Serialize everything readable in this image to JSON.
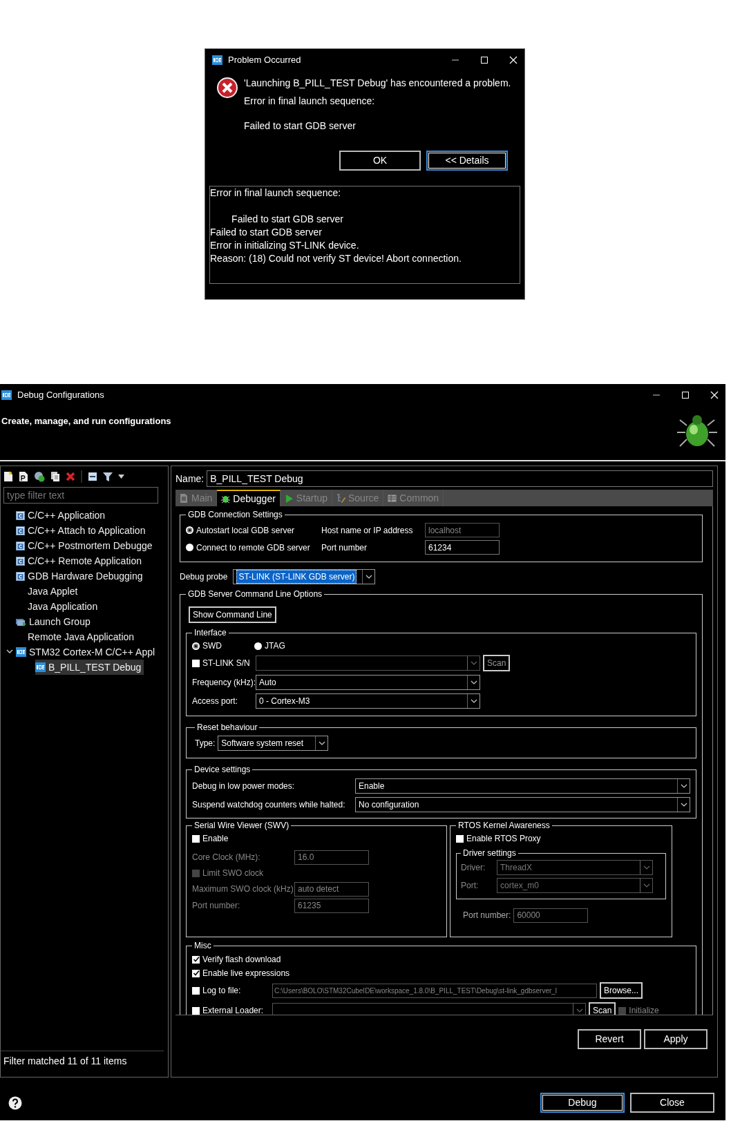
{
  "error_dialog": {
    "title": "Problem Occurred",
    "message": "'Launching B_PILL_TEST Debug' has encountered a problem.",
    "summary": "Error in final launch sequence:",
    "reason": "Failed to start GDB server",
    "buttons": [
      {
        "label": "OK",
        "default": false
      },
      {
        "label": "<< Details",
        "default": true
      }
    ],
    "details": "Error in final launch sequence:\n\n        Failed to start GDB server\nFailed to start GDB server\nError in initializing ST-LINK device.\nReason: (18) Could not verify ST device! Abort connection."
  },
  "window": {
    "title": "Debug Configurations",
    "subtitle": "Create, manage, and run configurations"
  },
  "sidebar": {
    "filter_placeholder": "type filter text",
    "tree": [
      {
        "label": "C/C++ Application",
        "kind": "c",
        "selected": false
      },
      {
        "label": "C/C++ Attach to Application",
        "kind": "c",
        "selected": false
      },
      {
        "label": "C/C++ Postmortem Debugge",
        "kind": "c",
        "selected": false
      },
      {
        "label": "C/C++ Remote Application",
        "kind": "c",
        "selected": false
      },
      {
        "label": "GDB Hardware Debugging",
        "kind": "c",
        "selected": false
      },
      {
        "label": "Java Applet",
        "kind": "plain",
        "selected": false
      },
      {
        "label": "Java Application",
        "kind": "plain",
        "selected": false
      },
      {
        "label": "Launch Group",
        "kind": "launch",
        "selected": false
      },
      {
        "label": "Remote Java Application",
        "kind": "plain",
        "selected": false
      },
      {
        "label": "STM32 Cortex-M C/C++ Appl",
        "kind": "ide",
        "selected": false,
        "expanded": true,
        "children": [
          {
            "label": "B_PILL_TEST Debug",
            "kind": "ide",
            "selected": true
          }
        ]
      }
    ],
    "status": "Filter matched 11 of 11 items"
  },
  "config": {
    "name_label": "Name:",
    "name": "B_PILL_TEST Debug",
    "tabs": [
      {
        "label": "Main",
        "kind": "page",
        "selected": false
      },
      {
        "label": "Debugger",
        "kind": "bug",
        "selected": true
      },
      {
        "label": "Startup",
        "kind": "play",
        "selected": false
      },
      {
        "label": "Source",
        "kind": "source",
        "selected": false
      },
      {
        "label": "Common",
        "kind": "table",
        "selected": false
      }
    ],
    "gdb_connection": {
      "title": "GDB Connection Settings",
      "modes": [
        {
          "label": "Autostart local GDB server",
          "selected": true
        },
        {
          "label": "Connect to remote GDB server",
          "selected": false
        }
      ],
      "host": {
        "label": "Host name or IP address",
        "value": "localhost",
        "disabled": true
      },
      "port": {
        "label": "Port number",
        "value": "61234",
        "disabled": false
      }
    },
    "debug_probe": {
      "label": "Debug probe",
      "value": "ST-LINK (ST-LINK GDB server)"
    },
    "server_options": {
      "title": "GDB Server Command Line Options",
      "show_command_line": "Show Command Line",
      "interface": {
        "title": "Interface",
        "modes": [
          {
            "label": "SWD",
            "selected": true
          },
          {
            "label": "JTAG",
            "selected": false
          }
        ],
        "serial": {
          "label": "ST-LINK S/N",
          "checked": false,
          "scan": "Scan"
        },
        "frequency": {
          "label": "Frequency (kHz):",
          "value": "Auto"
        },
        "access_port": {
          "label": "Access port:",
          "value": "0 - Cortex-M3"
        }
      },
      "reset": {
        "title": "Reset behaviour",
        "type_label": "Type:",
        "type": "Software system reset"
      },
      "device": {
        "title": "Device settings",
        "rows": [
          {
            "label": "Debug in low power modes:",
            "value": "Enable"
          },
          {
            "label": "Suspend watchdog counters while halted:",
            "value": "No configuration"
          }
        ]
      },
      "swv": {
        "title": "Serial Wire Viewer (SWV)",
        "enable": {
          "label": "Enable",
          "checked": false
        },
        "core_clock": {
          "label": "Core Clock (MHz):",
          "value": "16.0"
        },
        "limit": {
          "label": "Limit SWO clock",
          "checked": false
        },
        "max_clock": {
          "label": "Maximum SWO clock (kHz):",
          "value": "auto detect"
        },
        "port": {
          "label": "Port number:",
          "value": "61235"
        }
      },
      "rtos": {
        "title": "RTOS Kernel Awareness",
        "enable": {
          "label": "Enable RTOS Proxy",
          "checked": false
        },
        "driver_title": "Driver settings",
        "driver": {
          "label": "Driver:",
          "value": "ThreadX"
        },
        "port": {
          "label": "Port:",
          "value": "cortex_m0"
        },
        "port_number": {
          "label": "Port number:",
          "value": "60000"
        }
      },
      "misc": {
        "title": "Misc",
        "verify": {
          "label": "Verify flash download",
          "checked": true
        },
        "live": {
          "label": "Enable live expressions",
          "checked": true
        },
        "log": {
          "label": "Log to file:",
          "checked": false,
          "path": "C:\\Users\\BOLO\\STM32CubeIDE\\workspace_1.8.0\\B_PILL_TEST\\Debug\\st-link_gdbserver_l",
          "browse": "Browse..."
        },
        "loader": {
          "label": "External Loader:",
          "checked": false,
          "scan": "Scan",
          "initialize": {
            "label": "Initialize",
            "checked": false
          }
        }
      }
    },
    "revert": "Revert",
    "apply": "Apply"
  },
  "footer": {
    "debug": "Debug",
    "close": "Close"
  }
}
